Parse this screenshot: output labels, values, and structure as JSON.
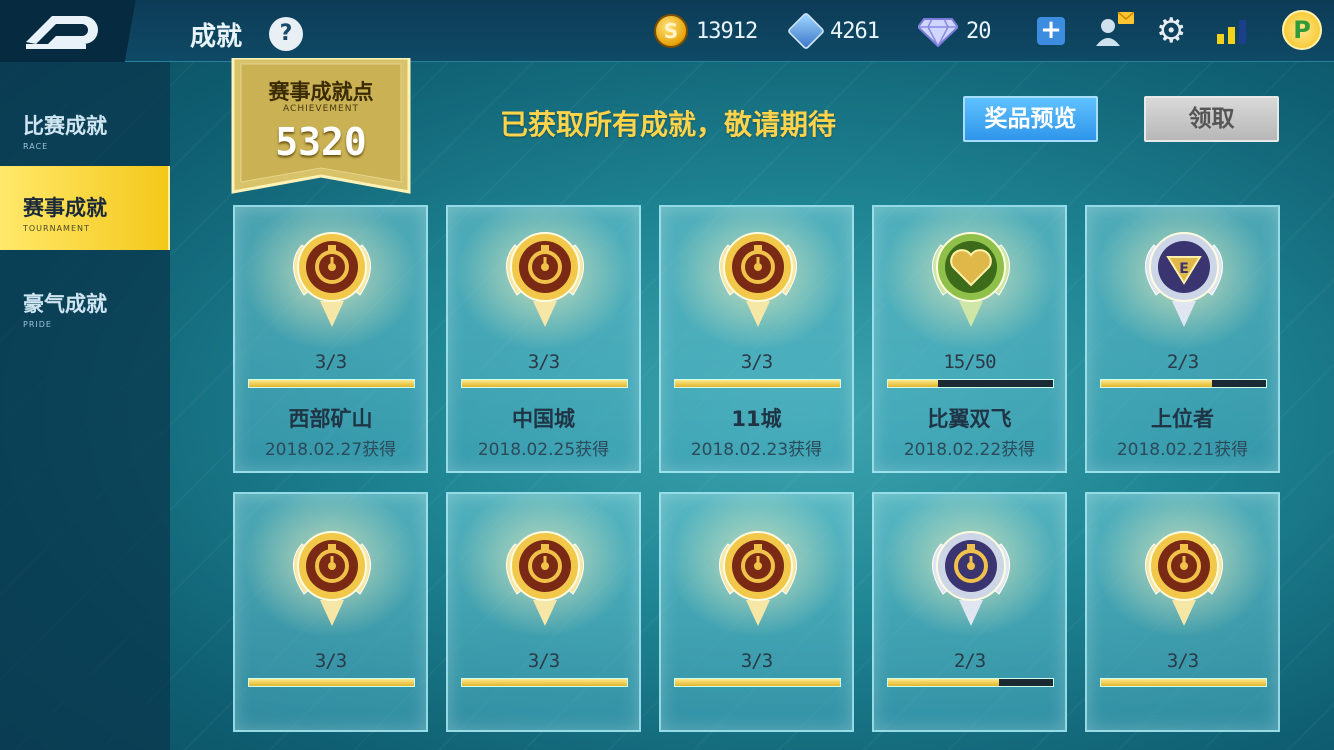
{
  "header": {
    "title": "成就",
    "help": "?",
    "coins": "13912",
    "tickets": "4261",
    "diamonds": "20",
    "plus": "+",
    "avatar_letter": "P"
  },
  "sidebar": {
    "items": [
      {
        "zh": "比赛成就",
        "en": "RACE"
      },
      {
        "zh": "赛事成就",
        "en": "TOURNAMENT"
      },
      {
        "zh": "豪气成就",
        "en": "PRIDE"
      }
    ]
  },
  "banner": {
    "title": "赛事成就点",
    "subtitle": "ACHIEVEMENT",
    "value": "5320"
  },
  "status_message": "已获取所有成就，敬请期待",
  "buttons": {
    "preview": "奖品预览",
    "claim": "领取"
  },
  "achievements": [
    {
      "progress": "3/3",
      "fraction": 1.0,
      "name": "西部矿山",
      "date": "2018.02.27获得",
      "medal": "gold-stopwatch"
    },
    {
      "progress": "3/3",
      "fraction": 1.0,
      "name": "中国城",
      "date": "2018.02.25获得",
      "medal": "gold-stopwatch"
    },
    {
      "progress": "3/3",
      "fraction": 1.0,
      "name": "11城",
      "date": "2018.02.23获得",
      "medal": "gold-stopwatch"
    },
    {
      "progress": "15/50",
      "fraction": 0.3,
      "name": "比翼双飞",
      "date": "2018.02.22获得",
      "medal": "green-heart"
    },
    {
      "progress": "2/3",
      "fraction": 0.67,
      "name": "上位者",
      "date": "2018.02.21获得",
      "medal": "silver-triangle"
    },
    {
      "progress": "3/3",
      "fraction": 1.0,
      "medal": "gold-stopwatch"
    },
    {
      "progress": "3/3",
      "fraction": 1.0,
      "medal": "gold-stopwatch"
    },
    {
      "progress": "3/3",
      "fraction": 1.0,
      "medal": "gold-stopwatch"
    },
    {
      "progress": "2/3",
      "fraction": 0.67,
      "medal": "silver-stopwatch"
    },
    {
      "progress": "3/3",
      "fraction": 1.0,
      "medal": "gold-stopwatch"
    }
  ],
  "colors": {
    "accent": "#ffd34a",
    "button_blue": "#2f95ea",
    "tab_active": "#f3c81a"
  }
}
